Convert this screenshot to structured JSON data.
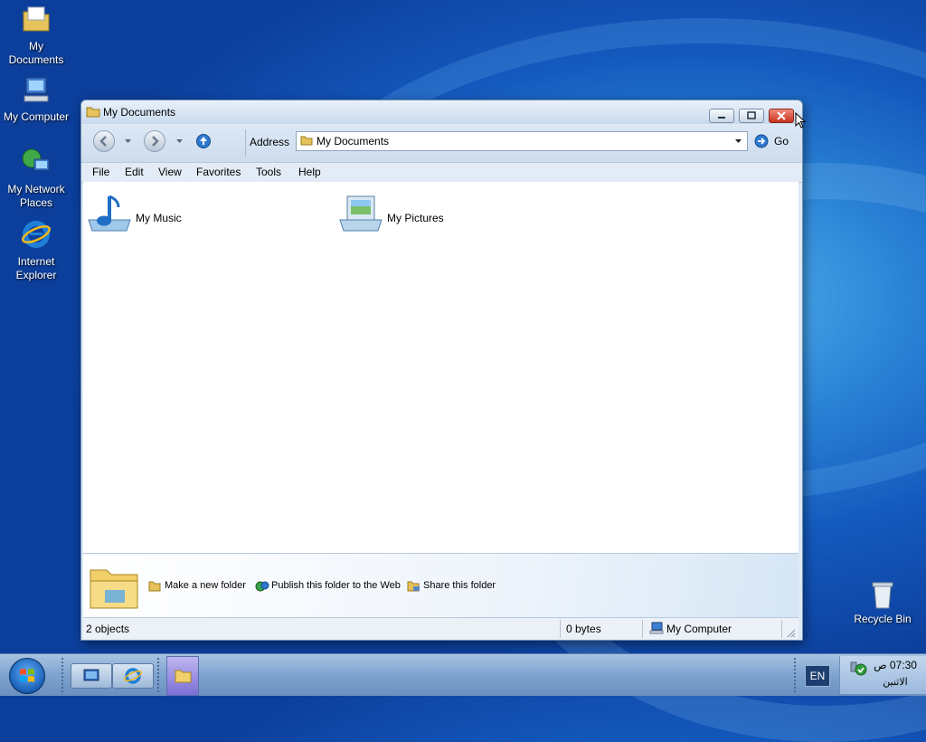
{
  "desktop": {
    "icons": [
      {
        "name": "my-documents-desktop-icon",
        "label_lines": [
          "My",
          "Documents"
        ]
      },
      {
        "name": "my-computer-desktop-icon",
        "label_lines": [
          "My Computer"
        ]
      },
      {
        "name": "my-network-places-desktop-icon",
        "label_lines": [
          "My Network",
          "Places"
        ]
      },
      {
        "name": "internet-explorer-desktop-icon",
        "label_lines": [
          "Internet",
          "Explorer"
        ]
      }
    ],
    "recycle_bin": "Recycle Bin"
  },
  "window": {
    "title": "My Documents",
    "address_label": "Address",
    "address_value": "My Documents",
    "go_label": "Go",
    "menu": [
      "File",
      "Edit",
      "View",
      "Favorites",
      "Tools",
      "Help"
    ],
    "items": [
      {
        "label": "My Music",
        "icon": "music-folder-icon"
      },
      {
        "label": "My Pictures",
        "icon": "pictures-folder-icon"
      }
    ],
    "tasks": [
      {
        "label": "Make a new folder",
        "icon": "new-folder-icon"
      },
      {
        "label": "Publish this folder to the Web",
        "icon": "publish-web-icon"
      },
      {
        "label": "Share this folder",
        "icon": "share-folder-icon"
      }
    ],
    "status": {
      "objects": "2 objects",
      "size": "0 bytes",
      "zone": "My Computer"
    }
  },
  "taskbar": {
    "language": "EN",
    "clock_time": "07:30 ص",
    "clock_day": "الاثنين"
  }
}
